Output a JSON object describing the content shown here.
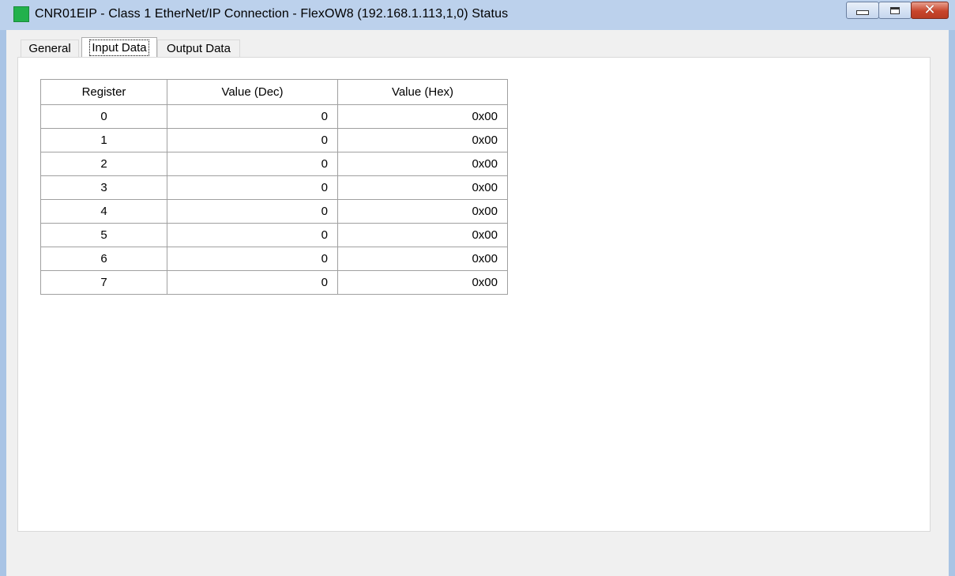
{
  "window": {
    "title": "CNR01EIP - Class 1 EtherNet/IP Connection - FlexOW8 (192.168.1.113,1,0) Status",
    "status_color": "#22b14c",
    "controls": [
      "minimize-icon",
      "maximize-icon",
      "close-icon"
    ],
    "close_glyph": "✕"
  },
  "tabs": [
    {
      "label": "General"
    },
    {
      "label": "Input Data",
      "selected": true
    },
    {
      "label": "Output Data"
    }
  ],
  "table": {
    "headers": [
      "Register",
      "Value (Dec)",
      "Value (Hex)"
    ],
    "rows": [
      [
        "0",
        "0",
        "0x00"
      ],
      [
        "1",
        "0",
        "0x00"
      ],
      [
        "2",
        "0",
        "0x00"
      ],
      [
        "3",
        "0",
        "0x00"
      ],
      [
        "4",
        "0",
        "0x00"
      ],
      [
        "5",
        "0",
        "0x00"
      ],
      [
        "6",
        "0",
        "0x00"
      ],
      [
        "7",
        "0",
        "0x00"
      ]
    ]
  }
}
